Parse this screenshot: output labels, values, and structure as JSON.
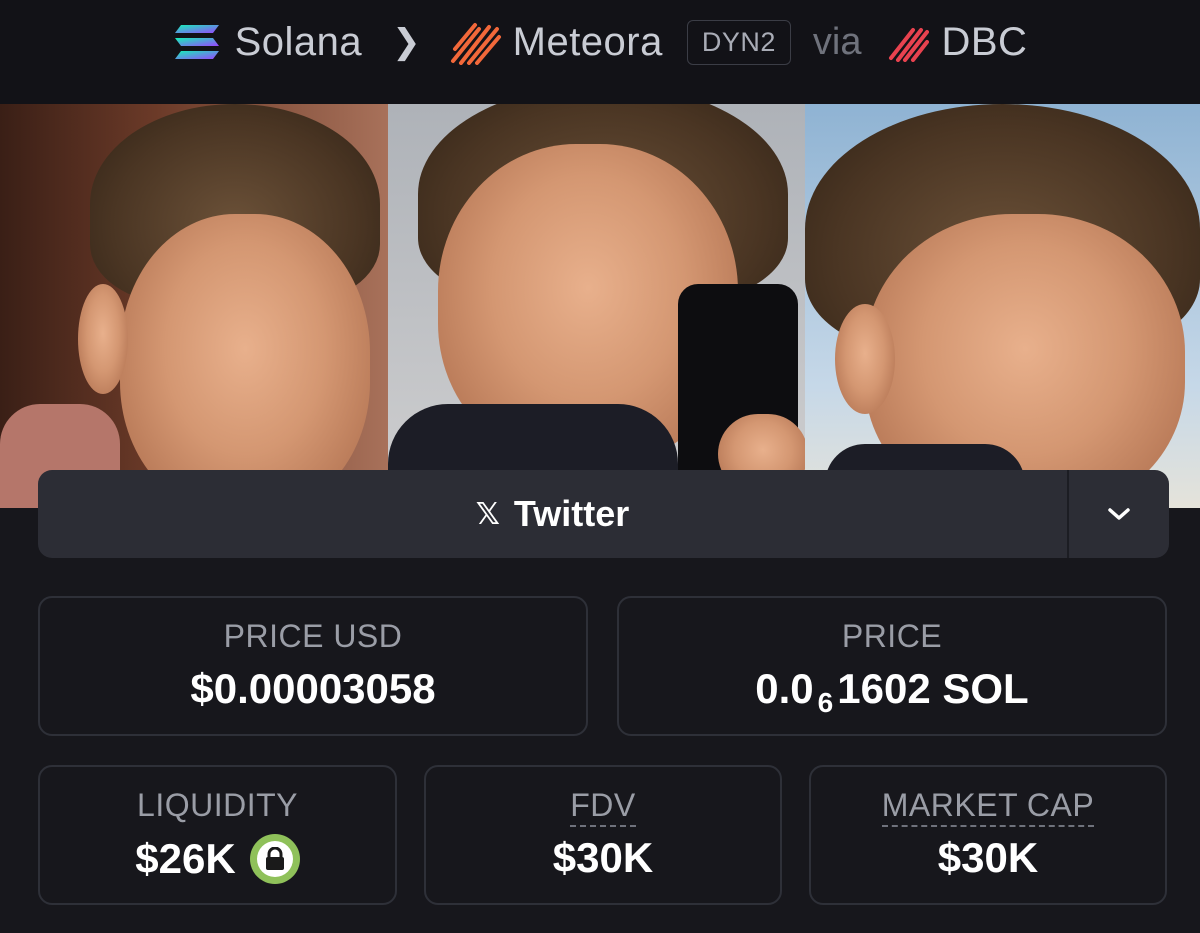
{
  "breadcrumb": {
    "chain": "Solana",
    "dex": "Meteora",
    "pool_type": "DYN2",
    "via": "via",
    "launchpad": "DBC"
  },
  "social": {
    "label": "Twitter",
    "icon": "x-logo-icon"
  },
  "stats": {
    "price_usd": {
      "label": "PRICE USD",
      "value": "$0.00003058"
    },
    "price": {
      "label": "PRICE",
      "prefix": "0.0",
      "zeros": "6",
      "suffix": "1602 SOL"
    },
    "liquidity": {
      "label": "LIQUIDITY",
      "value": "$26K"
    },
    "fdv": {
      "label": "FDV",
      "value": "$30K"
    },
    "market_cap": {
      "label": "MARKET CAP",
      "value": "$30K"
    }
  },
  "colors": {
    "background": "#17171c",
    "card_border": "#2e3038",
    "lock_green": "#8fc15a",
    "meteora_orange": "#f2683a",
    "dbc_red": "#e8424f"
  }
}
